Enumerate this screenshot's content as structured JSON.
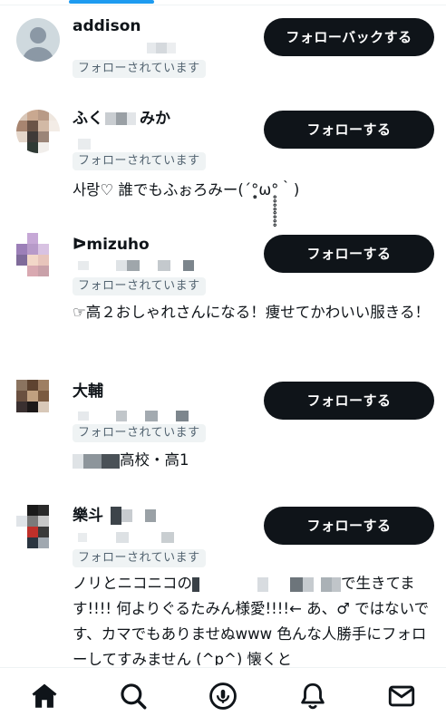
{
  "users": [
    {
      "name": "addison",
      "follows_badge": "フォローされています",
      "button_label": "フォローバックする",
      "bio": ""
    },
    {
      "name": "ふく",
      "name_suffix": "みか",
      "follows_badge": "フォローされています",
      "button_label": "フォローする",
      "bio": "사랑♡ 誰でもふぉろみー(´°̥̥̥̥̥̥̥̥ω°̥̥̥̥̥̥̥̥｀)"
    },
    {
      "name": "ᐅmizuho",
      "follows_badge": "フォローされています",
      "button_label": "フォローする",
      "bio": "☞高２おしゃれさんになる！痩せてかわいい服きる！"
    },
    {
      "name": "大輔",
      "follows_badge": "フォローされています",
      "button_label": "フォローする",
      "bio_suffix": "高校・高1"
    },
    {
      "name": "樂斗",
      "follows_badge": "フォローされています",
      "button_label": "フォローする",
      "bio_start": "ノリとニコニコの",
      "bio_tail": "で生き",
      "bio_rest": "てます!!!! 何よりぐるたみん様愛!!!!← あ、♂ ではないです、カマでもありませぬwww 色んな人勝手にフォローしてすみません (^p^) 懐くと"
    }
  ],
  "nav": {
    "items": [
      {
        "icon": "home-icon",
        "active": true
      },
      {
        "icon": "search-icon",
        "active": false
      },
      {
        "icon": "spaces-icon",
        "active": false
      },
      {
        "icon": "bell-icon",
        "active": false
      },
      {
        "icon": "mail-icon",
        "active": false
      }
    ]
  },
  "colors": {
    "accent": "#1d9bf0",
    "button_bg": "#0f1419",
    "badge_bg": "#eff3f4",
    "badge_text": "#536471"
  }
}
